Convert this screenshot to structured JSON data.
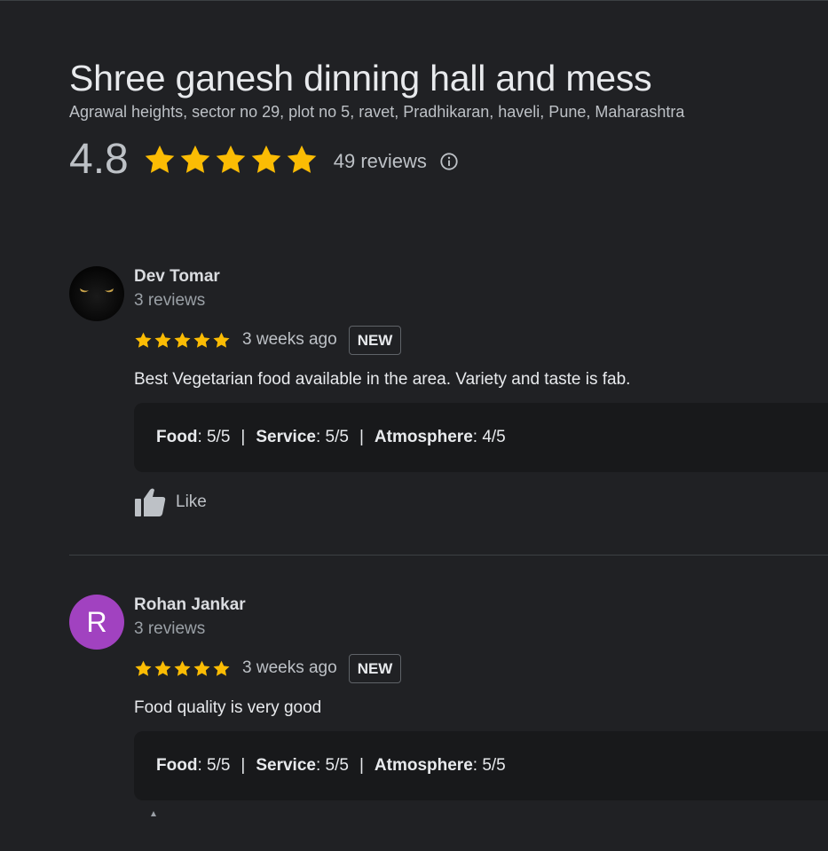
{
  "place": {
    "name": "Shree ganesh dinning hall and mess",
    "address": "Agrawal heights, sector no 29, plot no 5, ravet, Pradhikaran, haveli, Pune, Maharashtra",
    "rating": "4.8",
    "stars": 5,
    "review_count": "49 reviews",
    "info_icon": "info-circle-icon"
  },
  "colors": {
    "background": "#202124",
    "star": "#fbbc04",
    "avatar_r": "#a142c0"
  },
  "reviews": [
    {
      "name": "Dev Tomar",
      "meta": "3 reviews",
      "stars": 5,
      "time": "3 weeks ago",
      "badge": "NEW",
      "text": "Best Vegetarian food available in the area. Variety and taste is fab.",
      "sub_ratings": [
        {
          "label": "Food",
          "value": ": 5/5"
        },
        {
          "label": "Service",
          "value": ": 5/5"
        },
        {
          "label": "Atmosphere",
          "value": ": 4/5"
        }
      ],
      "separator": "|",
      "like_label": "Like",
      "like_icon": "thumbs-up-icon"
    },
    {
      "name": "Rohan Jankar",
      "meta": "3 reviews",
      "avatar_letter": "R",
      "stars": 5,
      "time": "3 weeks ago",
      "badge": "NEW",
      "text": "Food quality is very good",
      "sub_ratings": [
        {
          "label": "Food",
          "value": ": 5/5"
        },
        {
          "label": "Service",
          "value": ": 5/5"
        },
        {
          "label": "Atmosphere",
          "value": ": 5/5"
        }
      ],
      "separator": "|"
    }
  ]
}
